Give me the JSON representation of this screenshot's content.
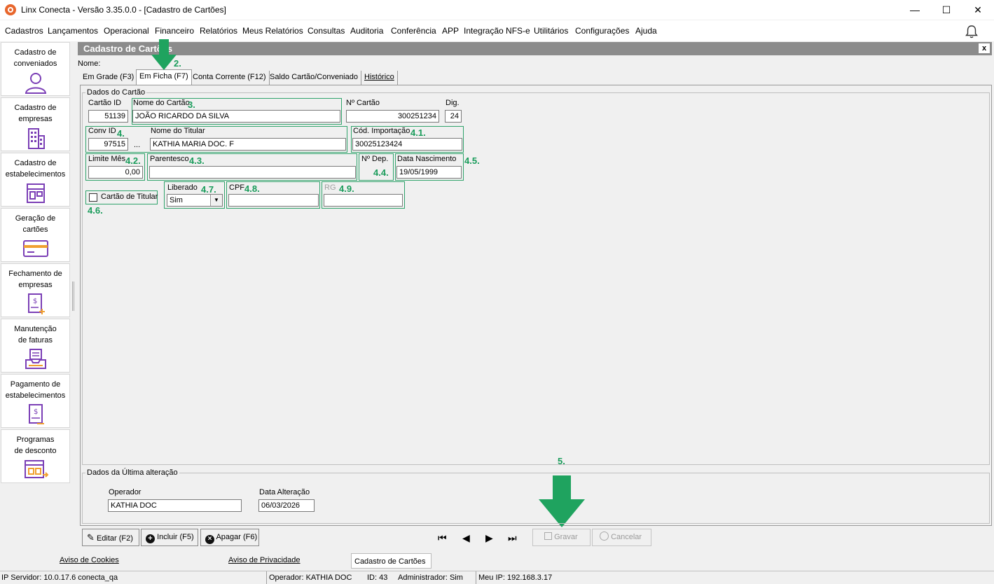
{
  "window": {
    "title": "Linx Conecta - Versão 3.35.0.0 - [Cadastro de Cartões]",
    "minimize": "—",
    "maximize": "☐",
    "close": "✕"
  },
  "menu": [
    "Cadastros",
    "Lançamentos",
    "Operacional",
    "Financeiro",
    "Relatórios",
    "Meus Relatórios",
    "Consultas",
    "Auditoria",
    "Conferência",
    "APP",
    "Integração NFS-e",
    "Utilitários",
    "Configurações",
    "Ajuda"
  ],
  "sidebar": {
    "items": [
      {
        "label1": "Cadastro de",
        "label2": "conveniados",
        "icon": "user-icon"
      },
      {
        "label1": "Cadastro de",
        "label2": "empresas",
        "icon": "building-icon"
      },
      {
        "label1": "Cadastro de",
        "label2": "estabelecimentos",
        "icon": "store-icon"
      },
      {
        "label1": "Geração de",
        "label2": "cartões",
        "icon": "card-icon"
      },
      {
        "label1": "Fechamento de",
        "label2": "empresas",
        "icon": "invoice-close-icon"
      },
      {
        "label1": "Manutenção",
        "label2": "de faturas",
        "icon": "inbox-tray-icon"
      },
      {
        "label1": "Pagamento de",
        "label2": "estabelecimentos",
        "icon": "payment-doc-icon"
      },
      {
        "label1": "Programas",
        "label2": "de desconto",
        "icon": "discount-program-icon"
      }
    ]
  },
  "form": {
    "title": "Cadastro de Cartões",
    "close": "x",
    "nome_label": "Nome:",
    "tabs": [
      "Em Grade (F3)",
      "Em Ficha (F7)",
      "Conta Corrente (F12)",
      "Saldo Cartão/Conveniado",
      "Histórico"
    ],
    "panel_title": "Dados do Cartão",
    "fields": {
      "cartao_id_label": "Cartão ID",
      "cartao_id": "51139",
      "nome_cartao_label": "Nome do Cartão",
      "nome_cartao": "JOÃO RICARDO DA SILVA",
      "n_cartao_label": "Nº Cartão",
      "n_cartao": "300251234",
      "dig_label": "Dig.",
      "dig": "24",
      "conv_id_label": "Conv ID",
      "conv_id": "97515",
      "conv_ellipsis": "...",
      "nome_titular_label": "Nome do Titular",
      "nome_titular": "KATHIA MARIA DOC. F",
      "cod_importacao_label": "Cód. Importação",
      "cod_importacao": "30025123424",
      "limite_mes_label": "Limite Mês",
      "limite_mes": "0,00",
      "parentesco_label": "Parentesco",
      "parentesco": "",
      "n_dep_label": "Nº Dep.",
      "data_nasc_label": "Data Nascimento",
      "data_nasc": "19/05/1999",
      "cartao_titular_label": "Cartão de Titular",
      "liberado_label": "Liberado",
      "liberado": "Sim",
      "cpf_label": "CPF",
      "cpf": "",
      "rg_label": "RG",
      "rg": ""
    },
    "last_change": {
      "title": "Dados da Última alteração",
      "operador_label": "Operador",
      "operador": "KATHIA DOC",
      "data_label": "Data Alteração",
      "data": "06/03/2026"
    },
    "buttons": {
      "editar": "Editar (F2)",
      "incluir": "Incluir (F5)",
      "apagar": "Apagar (F6)",
      "gravar": "Gravar",
      "cancelar": "Cancelar"
    }
  },
  "annotations": {
    "a2": "2.",
    "a3": "3.",
    "a4": "4.",
    "a41": "4.1.",
    "a42": "4.2.",
    "a43": "4.3.",
    "a44": "4.4.",
    "a45": "4.5.",
    "a46": "4.6.",
    "a47": "4.7.",
    "a48": "4.8.",
    "a49": "4.9.",
    "a5": "5."
  },
  "footer": {
    "cookies": "Aviso de Cookies",
    "privacidade": "Aviso de Privacidade",
    "active_tab": "Cadastro de Cartões"
  },
  "status": {
    "servidor": "IP Servidor: 10.0.17.6 conecta_qa",
    "operador": "Operador: KATHIA DOC",
    "id": "ID: 43",
    "admin": "Administrador: Sim",
    "meu_ip": "Meu IP: 192.168.3.17"
  },
  "colors": {
    "annotation": "#1a9c5b",
    "header": "#8c8c8c",
    "accent": "#7b3fb6"
  }
}
